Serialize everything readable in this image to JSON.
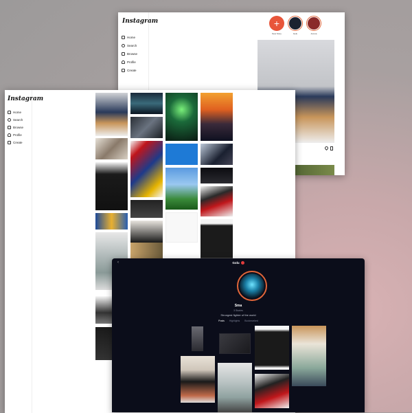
{
  "back_window": {
    "brand": "Instagram",
    "nav": [
      {
        "label": "Home",
        "icon": "home-icon"
      },
      {
        "label": "Search",
        "icon": "search-icon"
      },
      {
        "label": "Browse",
        "icon": "grid-icon"
      },
      {
        "label": "Profile",
        "icon": "user-icon"
      },
      {
        "label": "Create",
        "icon": "camera-icon"
      }
    ],
    "stories": [
      {
        "label": "New Story",
        "color": "#e8553a"
      },
      {
        "label": "Golu",
        "color": "#1b2230"
      },
      {
        "label": "Aroma",
        "color": "#8a2a2a"
      }
    ]
  },
  "middle_window": {
    "brand": "Instagram",
    "nav": [
      {
        "label": "Home",
        "icon": "home-icon"
      },
      {
        "label": "Search",
        "icon": "search-icon"
      },
      {
        "label": "Browse",
        "icon": "grid-icon"
      },
      {
        "label": "Profile",
        "icon": "user-icon"
      },
      {
        "label": "Create",
        "icon": "camera-icon"
      }
    ]
  },
  "profile_window": {
    "title": "Golu",
    "name": "Sma",
    "stats": "3 Stories",
    "bio": "Strongest fighter of the world",
    "tabs": [
      "Posts",
      "Highlights",
      "Bookmarked"
    ],
    "active_tab": "Posts"
  },
  "colors": {
    "accent": "#e8553a",
    "profile_bg": "#0b0d1a",
    "notification": "#e03c3c"
  }
}
